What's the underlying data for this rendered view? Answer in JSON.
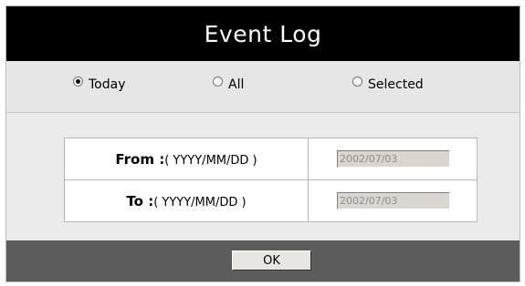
{
  "title": "Event Log",
  "period_options": [
    {
      "label": "Today",
      "checked": true
    },
    {
      "label": "All",
      "checked": false
    },
    {
      "label": "Selected",
      "checked": false
    }
  ],
  "range": {
    "from": {
      "label": "From :",
      "format": "( YYYY/MM/DD )",
      "value": "2002/07/03"
    },
    "to": {
      "label": "To :",
      "format": "( YYYY/MM/DD )",
      "value": "2002/07/03"
    }
  },
  "ok_label": "OK"
}
